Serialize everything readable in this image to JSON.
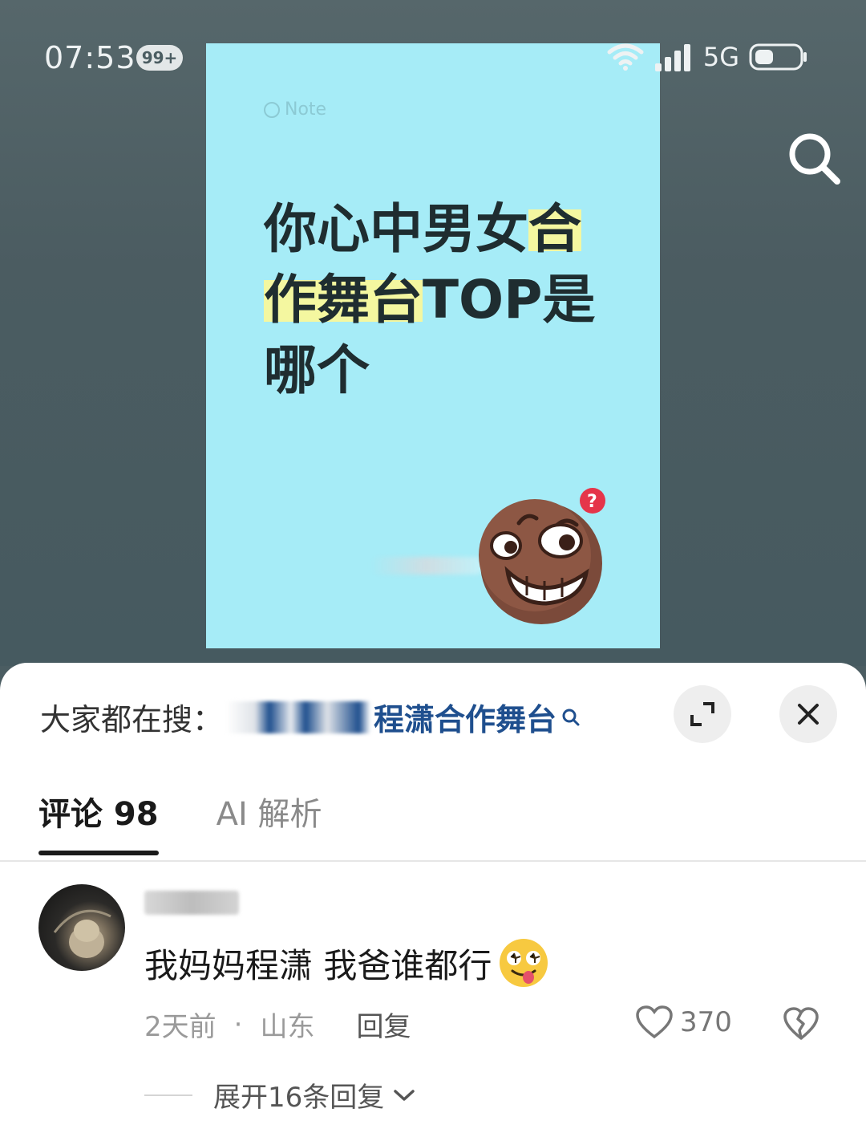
{
  "status_bar": {
    "time": "07:53",
    "notification_badge": "99+",
    "network": "5G"
  },
  "note": {
    "tag": "Note",
    "title_lines": [
      {
        "plain": "你心中男女",
        "highlight": "合"
      },
      {
        "highlight": "作舞台",
        "plain": "TOP是"
      },
      {
        "plain": "哪个"
      }
    ]
  },
  "sheet": {
    "search_prefix": "大家都在搜：",
    "search_query": "程潇合作舞台"
  },
  "tabs": [
    {
      "label": "评论 98",
      "active": true
    },
    {
      "label": "AI 解析",
      "active": false
    }
  ],
  "comment": {
    "text": "我妈妈程潇 我爸谁都行",
    "time": "2天前",
    "separator": "·",
    "location": "山东",
    "reply_label": "回复",
    "likes": "370",
    "expand_label": "展开16条回复"
  },
  "colors": {
    "card_bg": "#a6ecf7",
    "highlight": "#f4f7a0",
    "query_blue": "#1f4f8e",
    "backdrop": "#4b5d62"
  }
}
